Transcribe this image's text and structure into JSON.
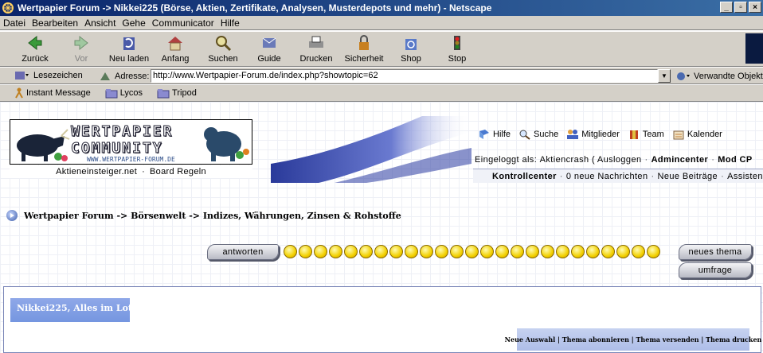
{
  "window": {
    "title": "Wertpapier Forum -> Nikkei225 (Börse, Aktien, Zertifikate, Analysen, Musterdepots und mehr) - Netscape",
    "minimize": "_",
    "maximize": "▫",
    "close": "×"
  },
  "menu": [
    "Datei",
    "Bearbeiten",
    "Ansicht",
    "Gehe",
    "Communicator",
    "Hilfe"
  ],
  "toolbar": {
    "back": "Zurück",
    "forward": "Vor",
    "reload": "Neu laden",
    "home": "Anfang",
    "search": "Suchen",
    "guide": "Guide",
    "print": "Drucken",
    "security": "Sicherheit",
    "shop": "Shop",
    "stop": "Stop"
  },
  "location": {
    "bookmarks": "Lesezeichen",
    "address_label": "Adresse:",
    "url": "http://www.Wertpapier-Forum.de/index.php?showtopic=62",
    "related": "Verwandte Objekte"
  },
  "personal_toolbar": [
    "Instant Message",
    "Lycos",
    "Tripod"
  ],
  "site": {
    "logo_line1": "WERTPAPIER",
    "logo_line2": "COMMUNITY",
    "logo_url": "WWW.WERTPAPIER-FORUM.DE",
    "links": [
      "Aktieneinsteiger.net",
      "Board Regeln"
    ],
    "link_sep": "·",
    "nav": [
      "Hilfe",
      "Suche",
      "Mitglieder",
      "Team",
      "Kalender"
    ],
    "login_prefix": "Eingeloggt als:",
    "login_user": "Aktiencrash",
    "logout": "( Ausloggen",
    "admincenter": "Admincenter",
    "modcp": "Mod CP",
    "control": "Kontrollcenter",
    "messages": "0 neue Nachrichten",
    "new_posts": "Neue Beiträge",
    "assistant": "Assistent"
  },
  "breadcrumb": "Wertpapier Forum -> Börsenwelt -> Indizes, Währungen, Zinsen & Rohstoffe",
  "buttons": {
    "reply": "antworten",
    "new_topic": "neues thema",
    "poll": "umfrage"
  },
  "topic": {
    "title": "Nikkei225, Alles im Lot",
    "actions": "Neue Auswahl | Thema abonnieren | Thema versenden | Thema drucken"
  }
}
